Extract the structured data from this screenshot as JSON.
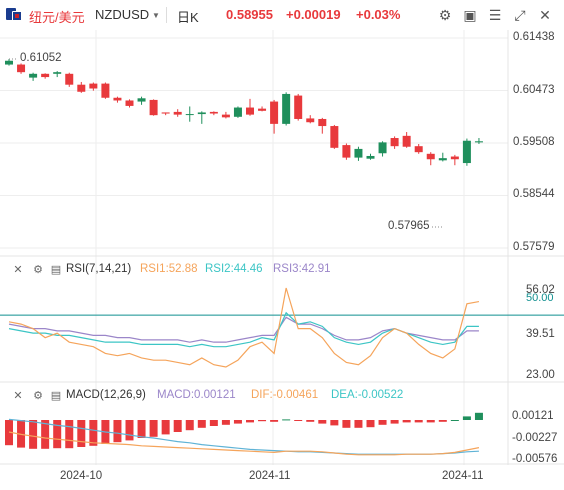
{
  "header": {
    "pair_cn": "纽元/美元",
    "pair_code": "NZDUSD",
    "period": "日K",
    "price": "0.58955",
    "change": "+0.00019",
    "change_pct": "+0.03%",
    "icons": [
      "dropdown-icon",
      "settings-icon",
      "image-icon",
      "checklist-icon",
      "expand-icon",
      "close-icon"
    ]
  },
  "colors": {
    "up": "#e8393c",
    "down": "#1f8f5c",
    "rsi1": "#f5a45b",
    "rsi2": "#3cc5c5",
    "rsi3": "#9b86c9",
    "macd_dif": "#f5a45b",
    "macd_dea": "#5fb3d6"
  },
  "rsi_panel": {
    "title": "RSI(7,14,21)",
    "rsi1": "RSI1:52.88",
    "rsi2": "RSI2:44.46",
    "rsi3": "RSI3:42.91",
    "ticks": [
      "56.02",
      "50.00",
      "39.51",
      "23.00"
    ]
  },
  "macd_panel": {
    "title": "MACD(12,26,9)",
    "macd": "MACD:0.00121",
    "dif": "DIF:-0.00461",
    "dea": "DEA:-0.00522",
    "ticks": [
      "0.00121",
      "-0.00227",
      "-0.00576"
    ]
  },
  "chart_data": {
    "type": "candlestick",
    "y_ticks": [
      "0.61438",
      "0.60473",
      "0.59508",
      "0.58544",
      "0.57579"
    ],
    "ylim": [
      0.57579,
      0.61438
    ],
    "x_ticks": [
      "2024-10",
      "2024-11",
      "2024-11"
    ],
    "annotations": {
      "high": "0.61052",
      "low": "0.57965"
    },
    "candles": [
      [
        0.6095,
        0.6102,
        0.6093,
        0.6105
      ],
      [
        0.6095,
        0.6081,
        0.6078,
        0.6097
      ],
      [
        0.6071,
        0.6078,
        0.6065,
        0.608
      ],
      [
        0.6078,
        0.6072,
        0.6069,
        0.6079
      ],
      [
        0.6078,
        0.6081,
        0.6072,
        0.6083
      ],
      [
        0.6078,
        0.6058,
        0.6054,
        0.608
      ],
      [
        0.6058,
        0.6045,
        0.6043,
        0.6063
      ],
      [
        0.606,
        0.6051,
        0.6047,
        0.6062
      ],
      [
        0.606,
        0.6034,
        0.6032,
        0.6062
      ],
      [
        0.6034,
        0.6029,
        0.6025,
        0.6036
      ],
      [
        0.6029,
        0.6019,
        0.6016,
        0.6031
      ],
      [
        0.6027,
        0.6033,
        0.6021,
        0.6036
      ],
      [
        0.603,
        0.6002,
        0.6001,
        0.6031
      ],
      [
        0.6007,
        0.6005,
        0.6002,
        0.6007
      ],
      [
        0.6008,
        0.6003,
        0.5999,
        0.6013
      ],
      [
        0.6003,
        0.6004,
        0.599,
        0.6018
      ],
      [
        0.6004,
        0.6007,
        0.5986,
        0.6009
      ],
      [
        0.6008,
        0.6005,
        0.6002,
        0.6009
      ],
      [
        0.6003,
        0.5998,
        0.5996,
        0.6008
      ],
      [
        0.5999,
        0.6016,
        0.5997,
        0.6018
      ],
      [
        0.6016,
        0.6003,
        0.6001,
        0.6032
      ],
      [
        0.6014,
        0.601,
        0.6009,
        0.6018
      ],
      [
        0.6027,
        0.5986,
        0.5968,
        0.603
      ],
      [
        0.5986,
        0.6041,
        0.5983,
        0.6044
      ],
      [
        0.6038,
        0.5995,
        0.5992,
        0.6041
      ],
      [
        0.5996,
        0.5989,
        0.5987,
        0.6002
      ],
      [
        0.5995,
        0.5982,
        0.5968,
        0.5997
      ],
      [
        0.5982,
        0.5942,
        0.594,
        0.5984
      ],
      [
        0.5947,
        0.5924,
        0.592,
        0.595
      ],
      [
        0.5924,
        0.594,
        0.5918,
        0.5944
      ],
      [
        0.5922,
        0.5927,
        0.592,
        0.5931
      ],
      [
        0.5932,
        0.5952,
        0.5926,
        0.5954
      ],
      [
        0.596,
        0.5945,
        0.594,
        0.5963
      ],
      [
        0.5964,
        0.5944,
        0.5942,
        0.5971
      ],
      [
        0.5945,
        0.5934,
        0.5931,
        0.5949
      ],
      [
        0.5931,
        0.5921,
        0.591,
        0.5934
      ],
      [
        0.5919,
        0.5923,
        0.5917,
        0.5933
      ],
      [
        0.5926,
        0.5921,
        0.591,
        0.5929
      ],
      [
        0.5914,
        0.5955,
        0.5909,
        0.5959
      ],
      [
        0.5952,
        0.5954,
        0.5949,
        0.596
      ]
    ],
    "rsi": {
      "ylim": [
        23.0,
        62.0
      ],
      "rsi1": [
        47,
        46,
        44,
        40,
        42,
        38,
        37,
        36,
        33,
        32,
        33,
        31,
        30,
        30,
        29,
        28,
        31,
        28,
        27,
        30,
        36,
        38,
        33,
        62,
        44,
        44,
        40,
        33,
        29,
        28,
        32,
        40,
        44,
        42,
        37,
        33,
        31,
        35,
        55,
        56
      ],
      "rsi2": [
        44,
        43,
        42,
        42,
        41,
        41,
        40,
        39,
        38,
        38,
        38,
        37,
        37,
        37,
        37,
        36,
        37,
        36,
        36,
        37,
        38,
        40,
        39,
        51,
        46,
        47,
        45,
        40,
        38,
        37,
        38,
        42,
        44,
        42,
        40,
        38,
        37,
        38,
        45,
        45
      ],
      "rsi3": [
        46,
        45,
        44,
        44,
        43,
        43,
        42,
        41,
        41,
        40,
        40,
        39,
        39,
        39,
        39,
        38,
        39,
        38,
        38,
        39,
        40,
        41,
        41,
        49,
        46,
        46,
        44,
        41,
        39,
        39,
        40,
        43,
        44,
        42,
        41,
        40,
        39,
        39,
        43,
        43
      ],
      "ref_line": 50.0
    },
    "macd": {
      "ylim": [
        -0.007,
        0.002
      ],
      "hist": [
        -0.0042,
        -0.0046,
        -0.0048,
        -0.0048,
        -0.0047,
        -0.0047,
        -0.0045,
        -0.0043,
        -0.004,
        -0.0037,
        -0.0034,
        -0.003,
        -0.0028,
        -0.0024,
        -0.002,
        -0.0017,
        -0.0013,
        -0.001,
        -0.0008,
        -0.0006,
        -0.0004,
        -0.0002,
        -0.0003,
        0.0001,
        -0.0001,
        -0.0003,
        -0.0006,
        -0.0009,
        -0.0013,
        -0.0013,
        -0.0012,
        -0.0008,
        -0.0006,
        -0.0004,
        -0.0004,
        -0.0004,
        -0.0003,
        0.0,
        0.0006,
        0.0012
      ],
      "dif": [
        -0.002,
        -0.0024,
        -0.0027,
        -0.003,
        -0.0032,
        -0.0034,
        -0.0036,
        -0.0038,
        -0.0039,
        -0.004,
        -0.0041,
        -0.0043,
        -0.0044,
        -0.0045,
        -0.0046,
        -0.0047,
        -0.0048,
        -0.0049,
        -0.005,
        -0.0051,
        -0.0052,
        -0.0053,
        -0.0054,
        -0.0052,
        -0.0052,
        -0.0052,
        -0.0053,
        -0.0055,
        -0.0057,
        -0.0058,
        -0.0058,
        -0.0058,
        -0.0058,
        -0.0057,
        -0.0057,
        -0.0057,
        -0.0056,
        -0.0054,
        -0.005,
        -0.0046
      ],
      "dea": [
        0.0001,
        -0.0001,
        -0.0003,
        -0.0006,
        -0.0009,
        -0.0011,
        -0.0014,
        -0.0017,
        -0.002,
        -0.0022,
        -0.0025,
        -0.0028,
        -0.003,
        -0.0033,
        -0.0036,
        -0.0038,
        -0.0041,
        -0.0043,
        -0.0045,
        -0.0047,
        -0.0049,
        -0.005,
        -0.0051,
        -0.0052,
        -0.0053,
        -0.0053,
        -0.0054,
        -0.0055,
        -0.0056,
        -0.0057,
        -0.0057,
        -0.0057,
        -0.0057,
        -0.0057,
        -0.0057,
        -0.0057,
        -0.0056,
        -0.0055,
        -0.0053,
        -0.0052
      ]
    }
  }
}
